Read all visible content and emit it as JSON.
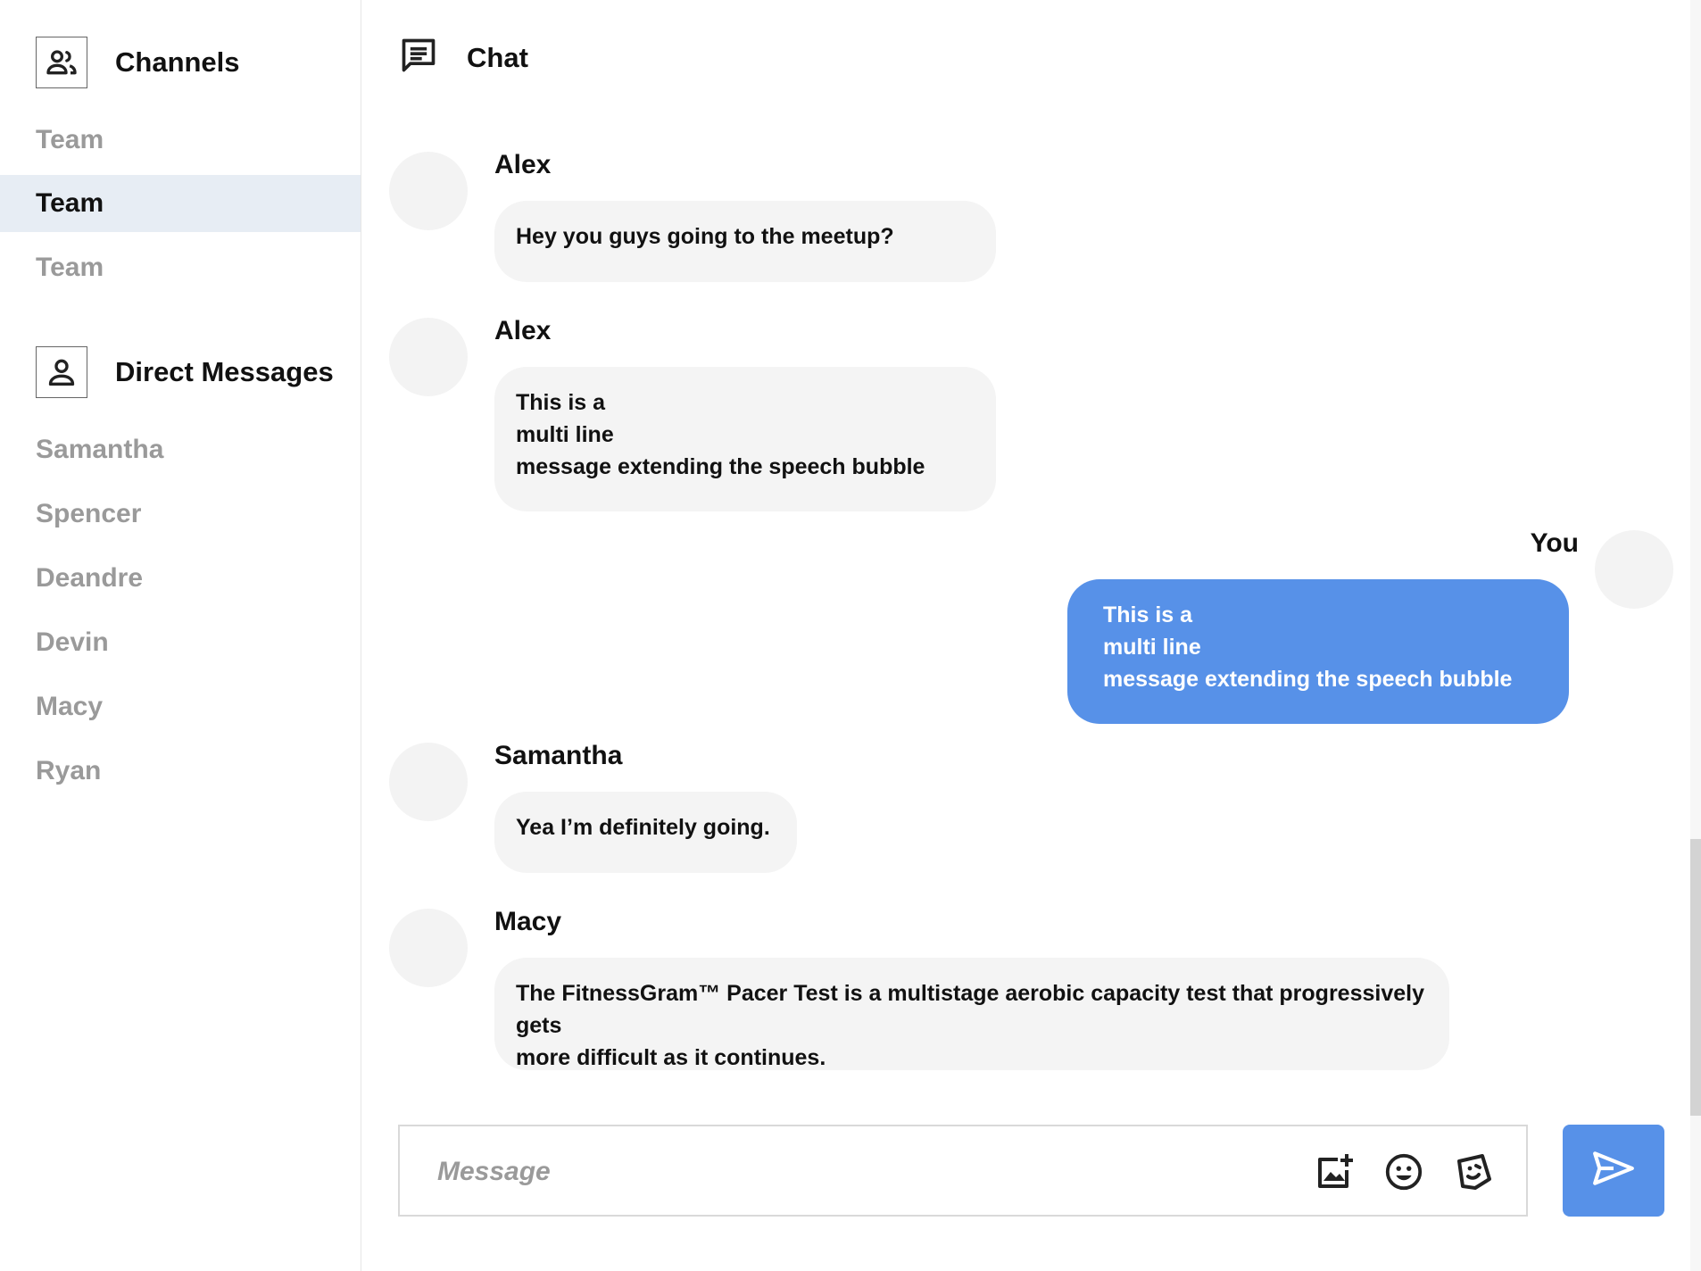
{
  "sidebar": {
    "channels_title": "Channels",
    "channels": [
      {
        "label": "Team",
        "active": false
      },
      {
        "label": "Team",
        "active": true
      },
      {
        "label": "Team",
        "active": false
      }
    ],
    "dm_title": "Direct Messages",
    "dms": [
      {
        "label": "Samantha"
      },
      {
        "label": "Spencer"
      },
      {
        "label": "Deandre"
      },
      {
        "label": "Devin"
      },
      {
        "label": "Macy"
      },
      {
        "label": "Ryan"
      }
    ]
  },
  "chat": {
    "title": "Chat",
    "messages": [
      {
        "sender": "Alex",
        "text": "Hey you guys going to the meetup?",
        "mine": false
      },
      {
        "sender": "Alex",
        "text": "This is a\nmulti line\nmessage extending the speech bubble",
        "mine": false
      },
      {
        "sender": "You",
        "text": "This is a\nmulti line\nmessage extending the speech bubble",
        "mine": true
      },
      {
        "sender": "Samantha",
        "text": "Yea I’m definitely going.",
        "mine": false
      },
      {
        "sender": "Macy",
        "text": "The FitnessGram™ Pacer Test is a multistage aerobic capacity test that progressively gets\nmore difficult as it continues.",
        "mine": false
      }
    ]
  },
  "composer": {
    "placeholder": "Message",
    "icons": [
      "add-image-icon",
      "emoji-icon",
      "sticker-icon"
    ],
    "send_icon": "send-icon"
  },
  "colors": {
    "accent": "#5791e8",
    "active_item_bg": "#e7edf4",
    "bubble_bg": "#f4f4f4",
    "muted_text": "#9a9a9a"
  }
}
